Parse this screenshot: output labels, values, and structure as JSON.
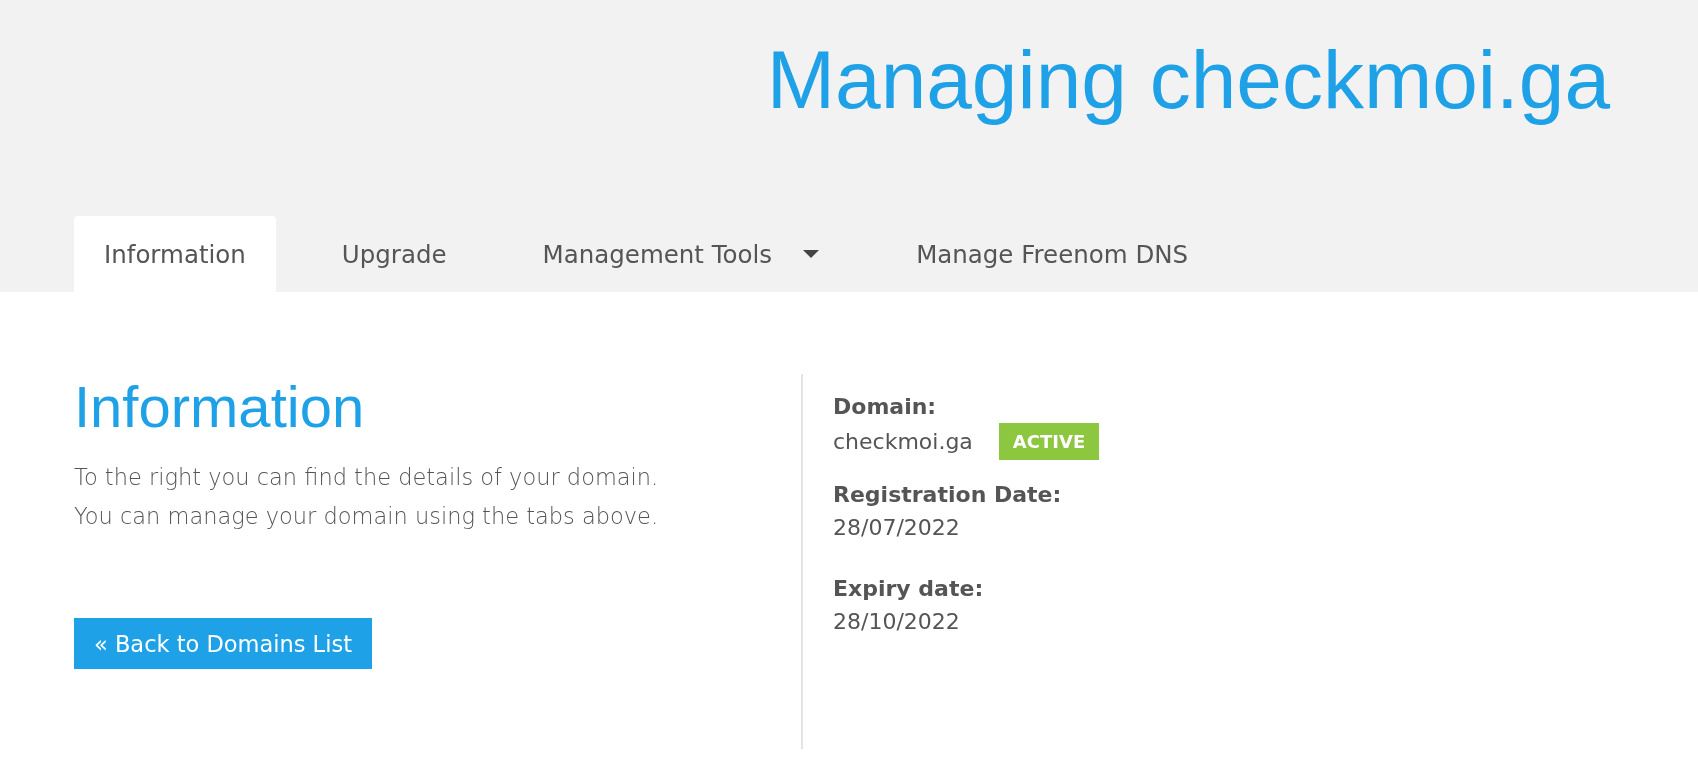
{
  "header": {
    "title": "Managing checkmoi.ga"
  },
  "tabs": [
    {
      "label": "Information",
      "selected": true,
      "dropdown": false
    },
    {
      "label": "Upgrade",
      "selected": false,
      "dropdown": false
    },
    {
      "label": "Management Tools",
      "selected": false,
      "dropdown": true
    },
    {
      "label": "Manage Freenom DNS",
      "selected": false,
      "dropdown": false
    }
  ],
  "info": {
    "heading": "Information",
    "lines": [
      "To the right you can find the details of your domain.",
      "You can manage your domain using the tabs above."
    ],
    "button": "« Back to Domains List"
  },
  "details": [
    {
      "label": "Domain:",
      "value": "checkmoi.ga",
      "status": {
        "label": "ACTIVE",
        "kind": "active"
      }
    },
    {
      "label": "Registration Date:",
      "value": "28/07/2022"
    },
    {
      "label": "Expiry date:",
      "value": "28/10/2022"
    }
  ]
}
